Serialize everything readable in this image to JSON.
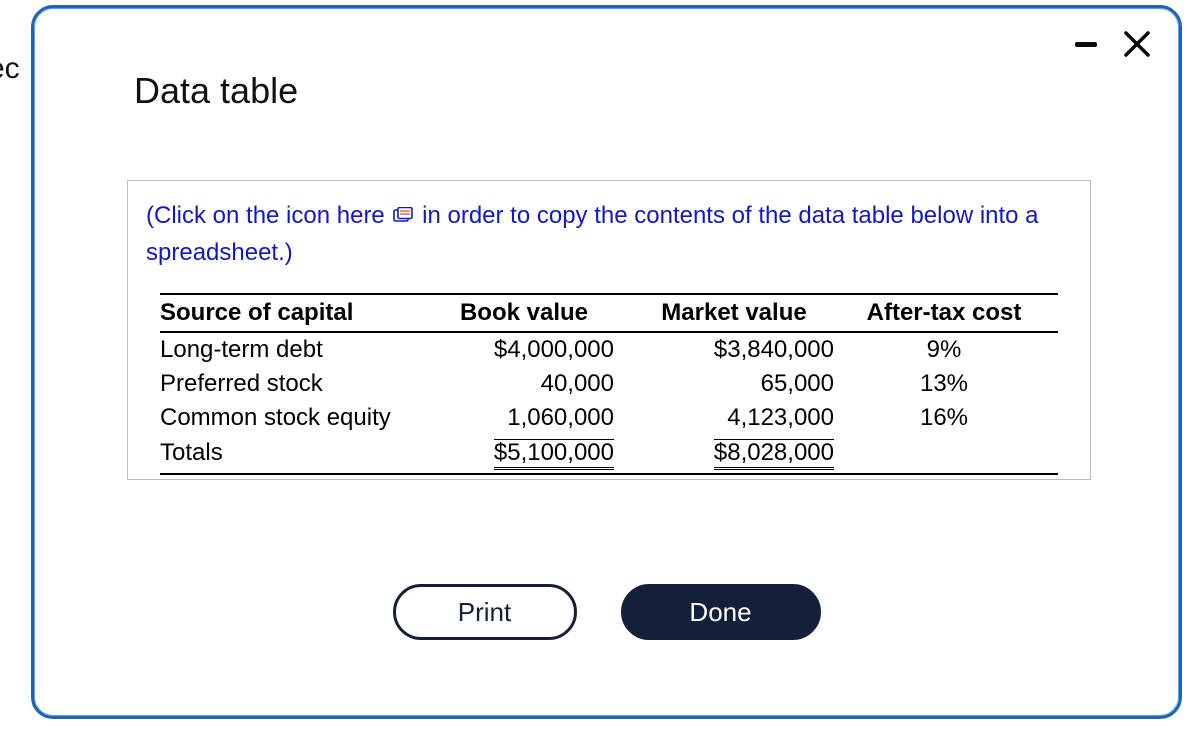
{
  "background_fragment": "ec",
  "window": {
    "title": "Data table"
  },
  "instruction": {
    "part1": "(Click on the icon  here",
    "part2": "in order to copy the contents of the data table below into a spreadsheet.)"
  },
  "table": {
    "headers": {
      "source": "Source of capital",
      "book": "Book value",
      "market": "Market value",
      "cost": "After-tax cost"
    },
    "rows": [
      {
        "source": "Long-term debt",
        "book": "$4,000,000",
        "market": "$3,840,000",
        "cost": "9%"
      },
      {
        "source": "Preferred stock",
        "book": "40,000",
        "market": "65,000",
        "cost": "13%"
      },
      {
        "source": "Common stock equity",
        "book": "1,060,000",
        "market": "4,123,000",
        "cost": "16%"
      }
    ],
    "totals": {
      "label": "Totals",
      "book": "$5,100,000",
      "market": "$8,028,000"
    }
  },
  "buttons": {
    "print": "Print",
    "done": "Done"
  },
  "chart_data": {
    "type": "table",
    "columns": [
      "Source of capital",
      "Book value",
      "Market value",
      "After-tax cost"
    ],
    "rows": [
      [
        "Long-term debt",
        4000000,
        3840000,
        0.09
      ],
      [
        "Preferred stock",
        40000,
        65000,
        0.13
      ],
      [
        "Common stock equity",
        1060000,
        4123000,
        0.16
      ]
    ],
    "totals": {
      "Book value": 5100000,
      "Market value": 8028000
    }
  }
}
